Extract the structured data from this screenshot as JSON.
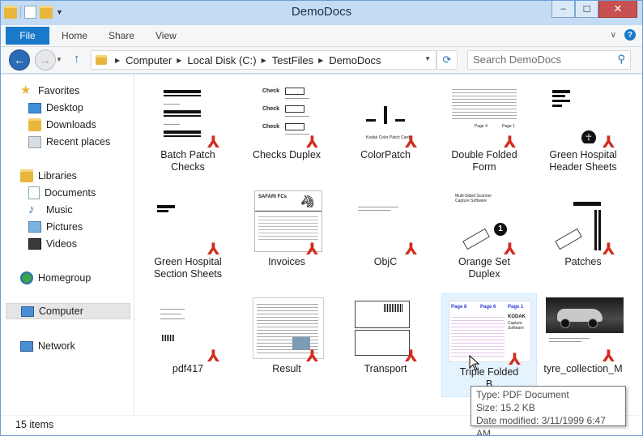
{
  "window": {
    "title": "DemoDocs",
    "buttons": {
      "minimize": "–",
      "maximize": "☐",
      "close": "✕"
    }
  },
  "ribbon": {
    "tabs": [
      "File",
      "Home",
      "Share",
      "View"
    ],
    "help": "?"
  },
  "address": {
    "crumbs": [
      "Computer",
      "Local Disk (C:)",
      "TestFiles",
      "DemoDocs"
    ],
    "search_placeholder": "Search DemoDocs"
  },
  "nav": {
    "favorites": "Favorites",
    "favorites_items": [
      "Desktop",
      "Downloads",
      "Recent places"
    ],
    "libraries": "Libraries",
    "libraries_items": [
      "Documents",
      "Music",
      "Pictures",
      "Videos"
    ],
    "homegroup": "Homegroup",
    "computer": "Computer",
    "network": "Network"
  },
  "files": [
    {
      "line1": "Batch Patch",
      "line2": "Checks"
    },
    {
      "line1": "Checks Duplex",
      "line2": ""
    },
    {
      "line1": "ColorPatch",
      "line2": ""
    },
    {
      "line1": "Double Folded",
      "line2": "Form"
    },
    {
      "line1": "Green Hospital",
      "line2": "Header Sheets"
    },
    {
      "line1": "Green Hospital",
      "line2": "Section Sheets"
    },
    {
      "line1": "Invoices",
      "line2": ""
    },
    {
      "line1": "ObjC",
      "line2": ""
    },
    {
      "line1": "Orange Set",
      "line2": "Duplex"
    },
    {
      "line1": "Patches",
      "line2": ""
    },
    {
      "line1": "pdf417",
      "line2": ""
    },
    {
      "line1": "Result",
      "line2": ""
    },
    {
      "line1": "Transport",
      "line2": ""
    },
    {
      "line1": "Triple Folded",
      "line2": "B"
    },
    {
      "line1": "tyre_collection_M",
      "line2": ""
    }
  ],
  "thumb_text": {
    "check": "Check",
    "kodak_color": "Kodak Color Patch Card",
    "page4": "Page 4",
    "page1": "Page 1",
    "safari": "SAFARI FCs",
    "multi_sided": "Multi-Sided Scanner Capture Software",
    "page8": "Page 8",
    "page6": "Page 6",
    "kodak": "KODAK",
    "capture_software": "Capture Software",
    "circle_num": "1"
  },
  "status": {
    "items": "15 items"
  },
  "tooltip": {
    "type": "Type: PDF Document",
    "size": "Size: 15.2 KB",
    "date": "Date modified: 3/11/1999 6:47 AM"
  },
  "colors": {
    "accent": "#1979ca",
    "pdf_red": "#d32b1e",
    "frame": "#c3dbf3"
  }
}
